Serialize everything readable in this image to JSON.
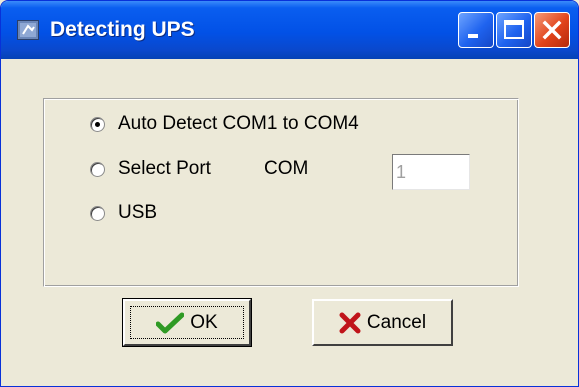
{
  "window": {
    "title": "Detecting UPS",
    "controls": {
      "minimize": "minimize-icon",
      "maximize": "maximize-icon",
      "close": "close-icon"
    }
  },
  "options": {
    "auto_detect": {
      "label": "Auto Detect COM1 to COM4",
      "selected": true
    },
    "select_port": {
      "label": "Select Port",
      "com_label": "COM",
      "port_value": "1",
      "selected": false
    },
    "usb": {
      "label": "USB",
      "selected": false
    }
  },
  "buttons": {
    "ok": {
      "label": "OK",
      "icon": "checkmark-icon"
    },
    "cancel": {
      "label": "Cancel",
      "icon": "x-mark-icon"
    }
  },
  "colors": {
    "titlebar": "#0251e6",
    "window_bg": "#ece9d8",
    "close_button": "#e1431a",
    "ok_icon": "#2f9a24",
    "cancel_icon": "#c0141a"
  }
}
